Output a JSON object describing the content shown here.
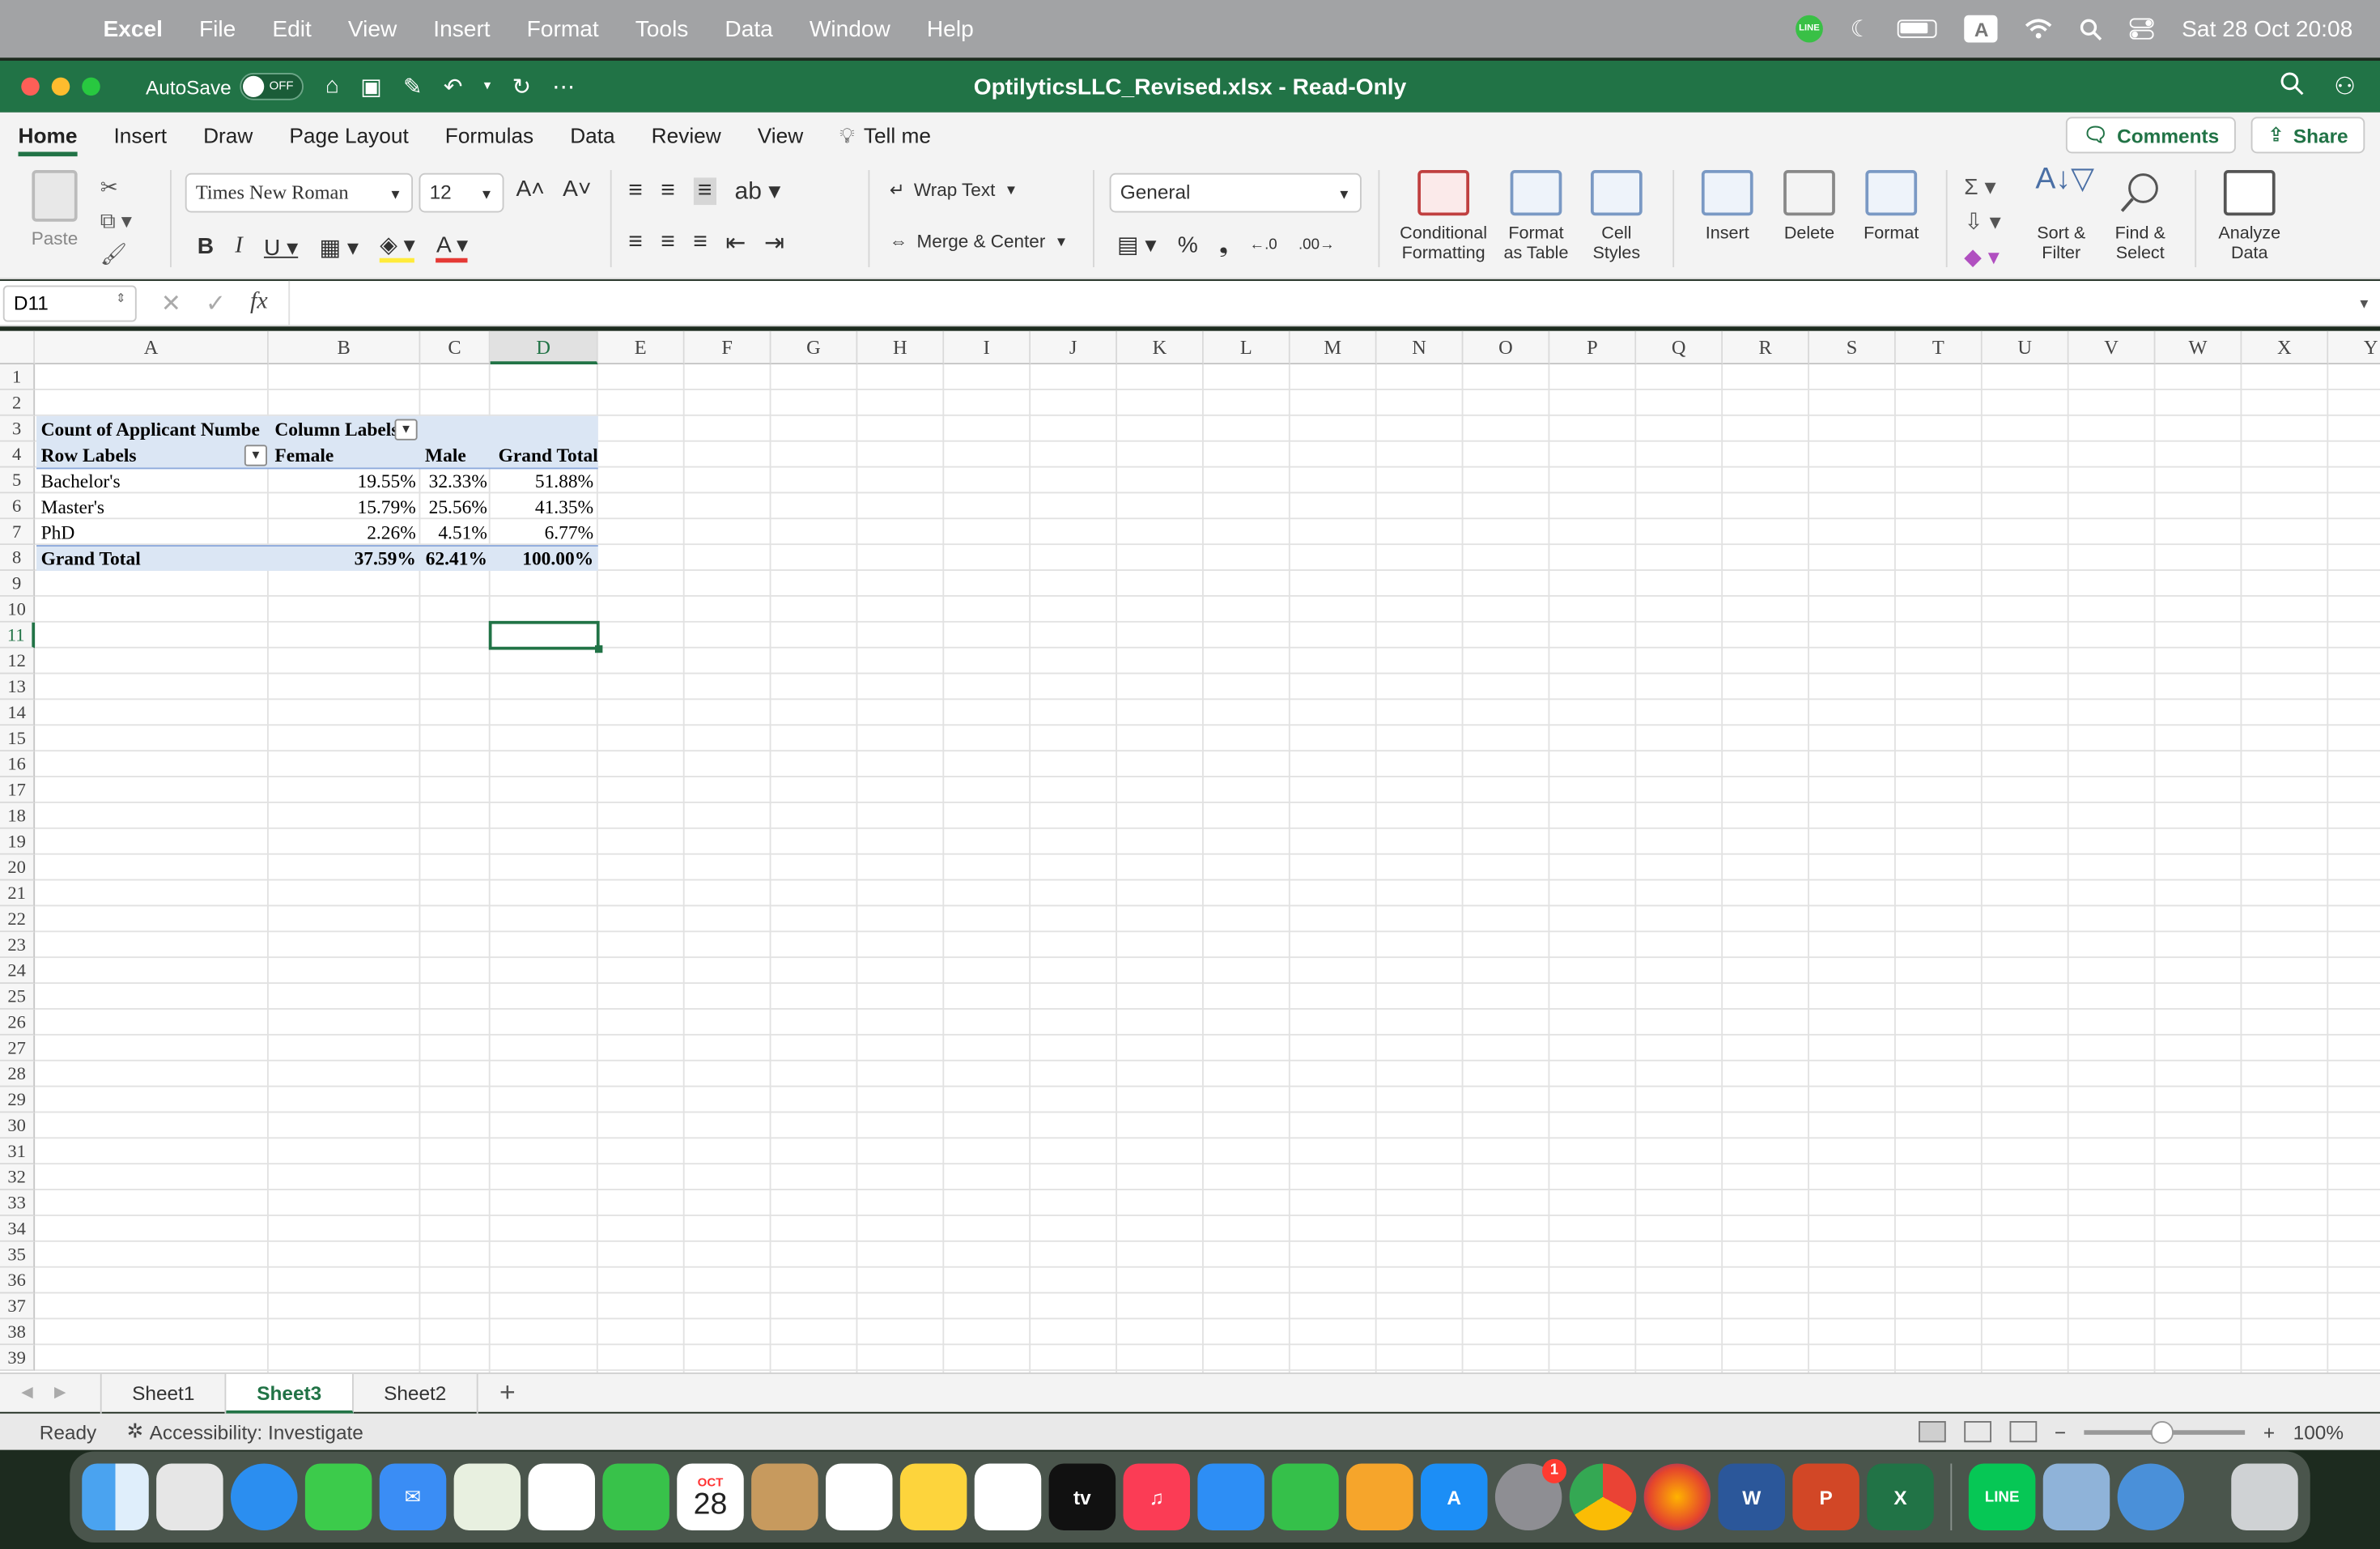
{
  "menubar": {
    "apple": "",
    "app": "Excel",
    "items": [
      "File",
      "Edit",
      "View",
      "Insert",
      "Format",
      "Tools",
      "Data",
      "Window",
      "Help"
    ],
    "line_label": "LINE",
    "input_source": "A",
    "datetime": "Sat 28 Oct  20:08"
  },
  "titlebar": {
    "autosave_label": "AutoSave",
    "autosave_state": "OFF",
    "title": "OptilyticsLLC_Revised.xlsx  -  Read-Only"
  },
  "ribbon_tabs": {
    "tabs": [
      "Home",
      "Insert",
      "Draw",
      "Page Layout",
      "Formulas",
      "Data",
      "Review",
      "View"
    ],
    "tell_me": "Tell me",
    "comments": "Comments",
    "share": "Share"
  },
  "ribbon": {
    "paste": "Paste",
    "font": "Times New Roman",
    "size": "12",
    "wrap_text": "Wrap Text",
    "merge_center": "Merge & Center",
    "number_format": "General",
    "conditional": [
      "Conditional",
      "Formatting"
    ],
    "format_table": [
      "Format",
      "as Table"
    ],
    "cell_styles": [
      "Cell",
      "Styles"
    ],
    "insert": "Insert",
    "delete": "Delete",
    "format": "Format",
    "sort": [
      "Sort &",
      "Filter"
    ],
    "find": [
      "Find &",
      "Select"
    ],
    "analyze": [
      "Analyze",
      "Data"
    ]
  },
  "formula_bar": {
    "name_box": "D11",
    "fx": "fx",
    "value": ""
  },
  "sheet": {
    "columns": [
      "A",
      "B",
      "C",
      "D",
      "E",
      "F",
      "G",
      "H",
      "I",
      "J",
      "K",
      "L",
      "M",
      "N",
      "O",
      "P",
      "Q",
      "R",
      "S",
      "T",
      "U",
      "V",
      "W",
      "X",
      "Y"
    ],
    "rows": [
      "1",
      "2",
      "3",
      "4",
      "5",
      "6",
      "7",
      "8",
      "9",
      "10",
      "11",
      "12",
      "13",
      "14",
      "15",
      "16",
      "17",
      "18",
      "19",
      "20",
      "21",
      "22",
      "23",
      "24",
      "25",
      "26",
      "27",
      "28",
      "29",
      "30",
      "31",
      "32",
      "33",
      "34",
      "35",
      "36",
      "37",
      "38",
      "39"
    ],
    "selected_cell": "D11",
    "pivot": {
      "title": "Count of Applicant Numbe",
      "col_labels": "Column Labels",
      "row_labels": "Row Labels",
      "headers": [
        "Female",
        "Male",
        "Grand Total"
      ],
      "rows": [
        {
          "label": "Bachelor's",
          "values": [
            "19.55%",
            "32.33%",
            "51.88%"
          ]
        },
        {
          "label": "Master's",
          "values": [
            "15.79%",
            "25.56%",
            "41.35%"
          ]
        },
        {
          "label": "PhD",
          "values": [
            "2.26%",
            "4.51%",
            "6.77%"
          ]
        }
      ],
      "total": {
        "label": "Grand Total",
        "values": [
          "37.59%",
          "62.41%",
          "100.00%"
        ]
      }
    }
  },
  "sheet_tabs": {
    "tabs": [
      "Sheet1",
      "Sheet3",
      "Sheet2"
    ],
    "active": "Sheet3",
    "add": "+"
  },
  "statusbar": {
    "ready": "Ready",
    "accessibility": "Accessibility: Investigate",
    "zoom": "100%"
  },
  "dock": {
    "calendar_month": "OCT",
    "calendar_day": "28",
    "settings_badge": "1",
    "tv_label": "tv",
    "line_label": "LINE"
  }
}
